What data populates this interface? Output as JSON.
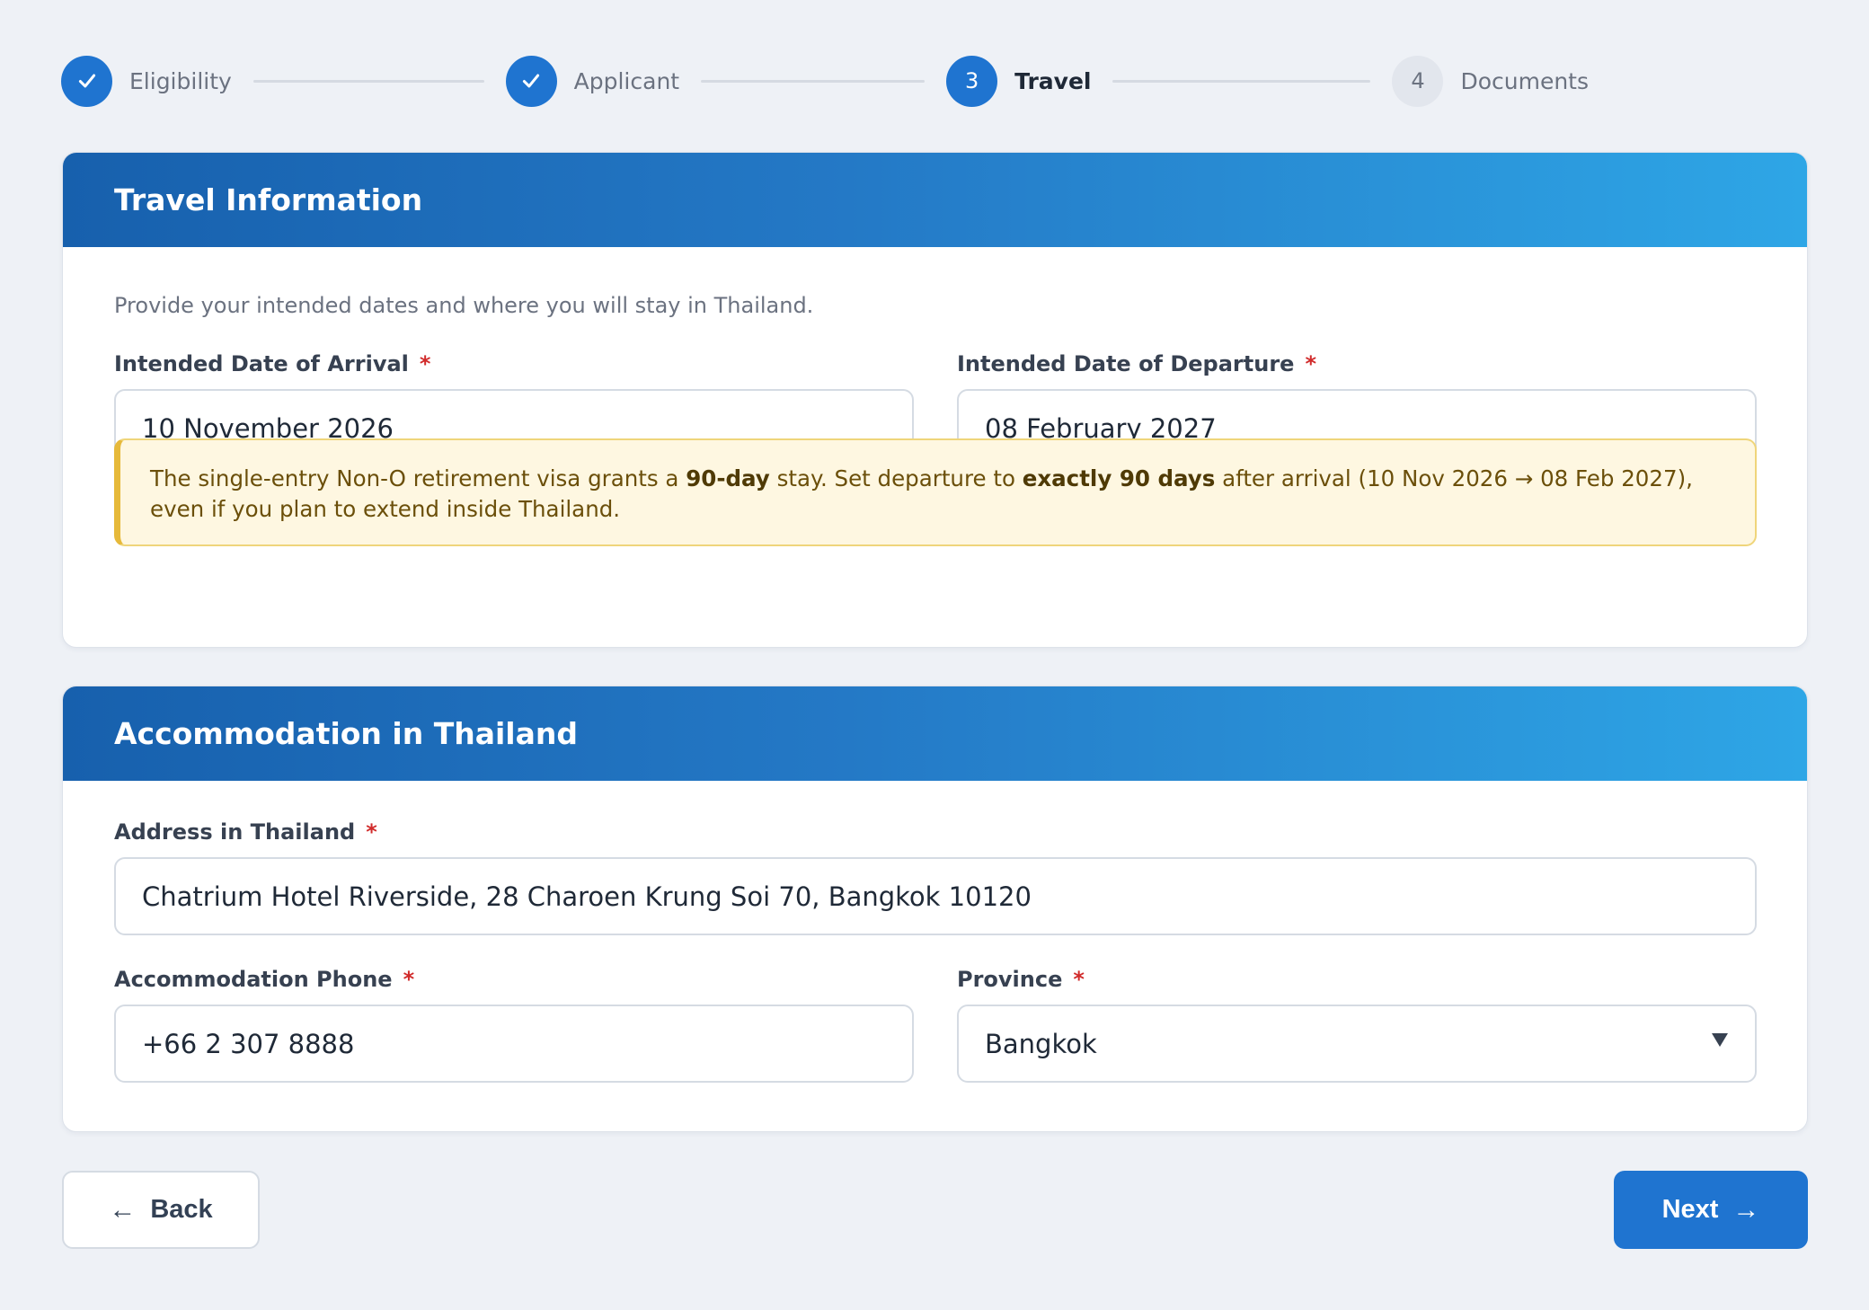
{
  "stepper": {
    "steps": [
      {
        "number": "✓",
        "label": "Eligibility",
        "state": "done"
      },
      {
        "number": "✓",
        "label": "Applicant",
        "state": "done"
      },
      {
        "number": "3",
        "label": "Travel",
        "state": "active"
      },
      {
        "number": "4",
        "label": "Documents",
        "state": "todo"
      }
    ]
  },
  "travel": {
    "title": "Travel Information",
    "description": "Provide your intended dates and where you will stay in Thailand.",
    "arrival_label": "Intended Date of Arrival",
    "arrival_value": "10 November 2026",
    "departure_label": "Intended Date of Departure",
    "departure_value": "08 February 2027",
    "required_mark": "*",
    "alert": {
      "t1": "The single-entry Non-O retirement visa grants a ",
      "b1": "90-day",
      "t2": " stay. Set departure to ",
      "b2": "exactly 90 days",
      "t3": " after arrival (10 Nov 2026 → 08 Feb 2027), even if you plan to extend inside Thailand."
    }
  },
  "accommodation": {
    "title": "Accommodation in Thailand",
    "address_label": "Address in Thailand",
    "address_value": "Chatrium Hotel Riverside, 28 Charoen Krung Soi 70, Bangkok 10120",
    "phone_label": "Accommodation Phone",
    "phone_value": "+66 2 307 8888",
    "province_label": "Province",
    "province_value": "Bangkok",
    "required_mark": "*"
  },
  "nav": {
    "back_arrow": "←",
    "back_label": "Back",
    "next_label": "Next",
    "next_arrow": "→"
  },
  "colors": {
    "accent": "#1f74d0",
    "header_start": "#1760ad",
    "header_end": "#2ea6e6",
    "required": "#d12b2b",
    "alert_bg": "#fef7e1",
    "alert_border": "#e6b93a"
  }
}
